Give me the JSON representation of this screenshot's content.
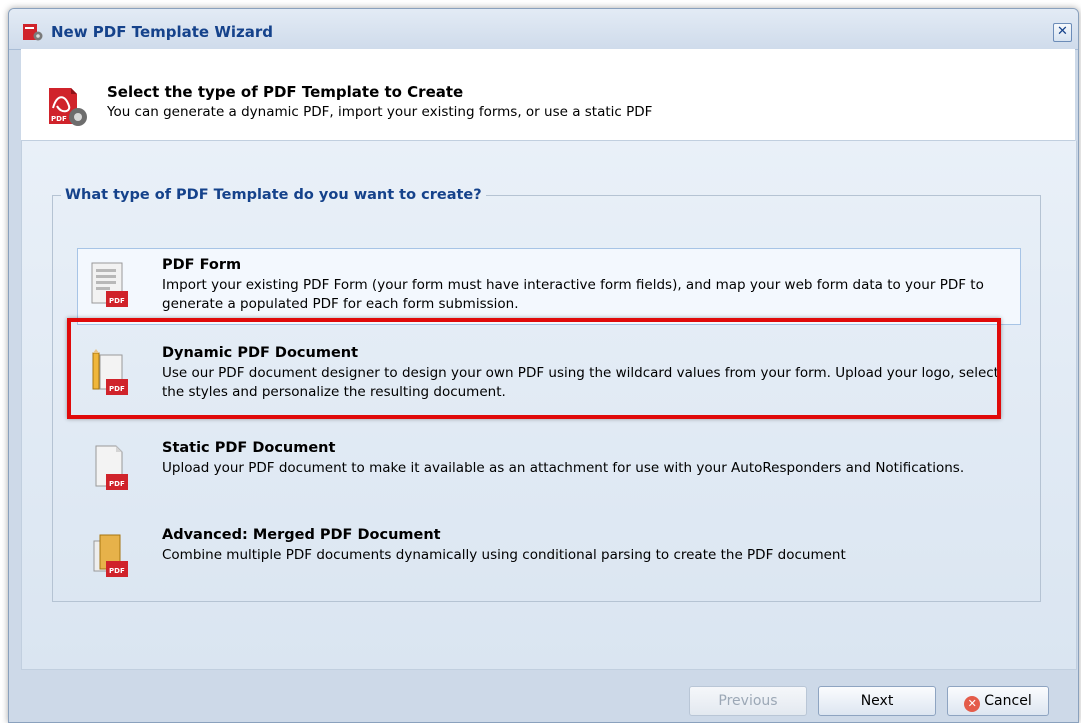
{
  "window": {
    "title": "New PDF Template Wizard",
    "close_glyph": "✕"
  },
  "header": {
    "title": "Select the type of PDF Template to Create",
    "subtitle": "You can generate a dynamic PDF, import your existing forms, or use a static PDF"
  },
  "question": "What type of PDF Template do you want to create?",
  "options": [
    {
      "title": "PDF Form",
      "description": "Import your existing PDF Form (your form must have interactive form fields), and map your web form data to your PDF to generate a populated PDF for each form submission.",
      "icon": "pdf-form-icon",
      "badge": "PDF"
    },
    {
      "title": "Dynamic PDF Document",
      "description": "Use our PDF document designer to design your own PDF using the wildcard values from your form. Upload your logo, select the styles and personalize the resulting document.",
      "icon": "dynamic-pdf-icon",
      "badge": "PDF"
    },
    {
      "title": "Static PDF Document",
      "description": "Upload your PDF document to make it available as an attachment for use with your AutoResponders and Notifications.",
      "icon": "static-pdf-icon",
      "badge": "PDF"
    },
    {
      "title": "Advanced: Merged PDF Document",
      "description": "Combine multiple PDF documents dynamically using conditional parsing to create the PDF document",
      "icon": "merged-pdf-icon",
      "badge": "PDF"
    }
  ],
  "buttons": {
    "previous": "Previous",
    "next": "Next",
    "cancel": "Cancel"
  },
  "colors": {
    "accent": "#15428b",
    "highlight_border": "#e00a0a",
    "pdf_red": "#d0232b"
  }
}
